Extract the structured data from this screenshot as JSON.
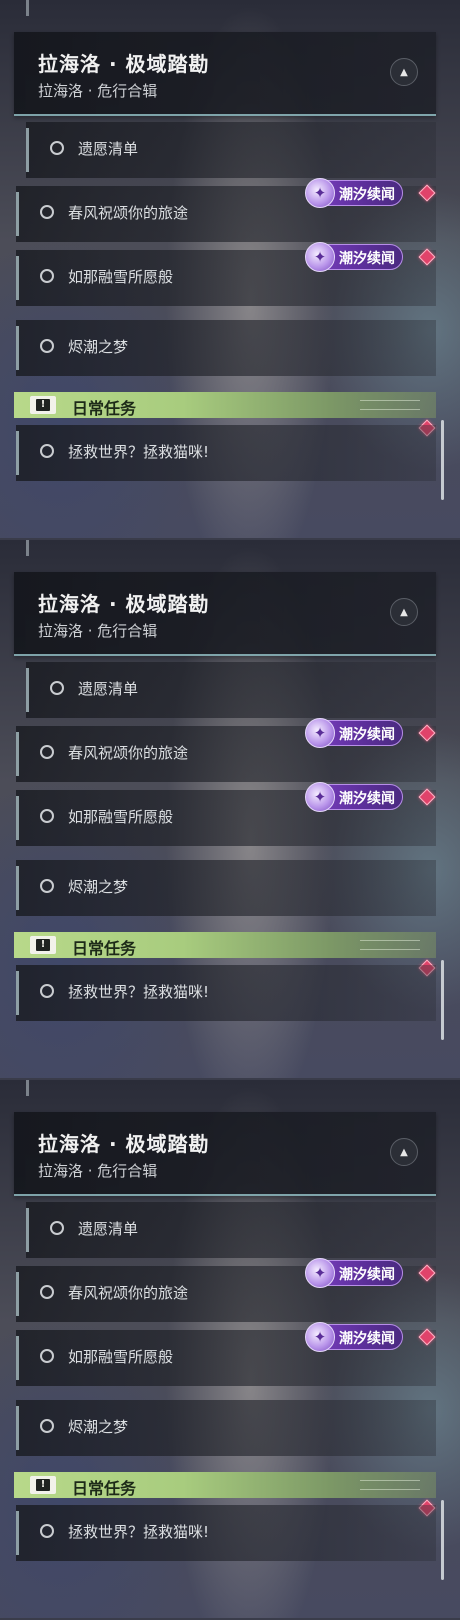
{
  "panels": [
    {
      "header": {
        "title": "拉海洛 · 极域踏勘",
        "subtitle": "拉海洛 · 危行合辑"
      },
      "quests": [
        {
          "label": "遗愿清单",
          "tag": null
        },
        {
          "label": "春风祝颂你的旅途",
          "tag": "潮汐续闻"
        },
        {
          "label": "如那融雪所愿般",
          "tag": "潮汐续闻"
        },
        {
          "label": "烬潮之梦",
          "tag": null
        }
      ],
      "section": {
        "title": "日常任务",
        "icon": "exclamation-icon"
      },
      "daily_quest": {
        "label": "拯救世界？拯救猫咪!"
      }
    },
    {
      "header": {
        "title": "拉海洛 · 极域踏勘",
        "subtitle": "拉海洛 · 危行合辑"
      },
      "quests": [
        {
          "label": "遗愿清单",
          "tag": null
        },
        {
          "label": "春风祝颂你的旅途",
          "tag": "潮汐续闻"
        },
        {
          "label": "如那融雪所愿般",
          "tag": "潮汐续闻"
        },
        {
          "label": "烬潮之梦",
          "tag": null
        }
      ],
      "section": {
        "title": "日常任务",
        "icon": "exclamation-icon"
      },
      "daily_quest": {
        "label": "拯救世界？拯救猫咪!"
      }
    },
    {
      "header": {
        "title": "拉海洛 · 极域踏勘",
        "subtitle": "拉海洛 · 危行合辑"
      },
      "quests": [
        {
          "label": "遗愿清单",
          "tag": null
        },
        {
          "label": "春风祝颂你的旅途",
          "tag": "潮汐续闻"
        },
        {
          "label": "如那融雪所愿般",
          "tag": "潮汐续闻"
        },
        {
          "label": "烬潮之梦",
          "tag": null
        }
      ],
      "section": {
        "title": "日常任务",
        "icon": "exclamation-icon"
      },
      "daily_quest": {
        "label": "拯救世界？拯救猫咪!"
      }
    }
  ],
  "colors": {
    "accent_green": "#b8d98a",
    "tag_purple": "#7a3fc0",
    "alert_red": "#e0436a"
  }
}
